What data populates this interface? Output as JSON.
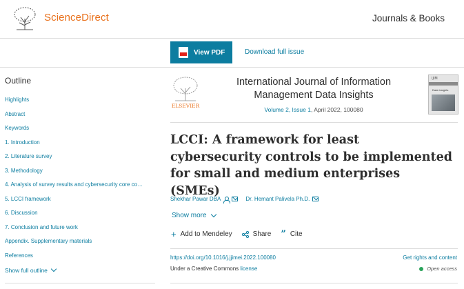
{
  "header": {
    "brand": "ScienceDirect",
    "journals_books": "Journals & Books"
  },
  "toolbar": {
    "view_pdf": "View PDF",
    "download_issue": "Download full issue"
  },
  "sidebar": {
    "title": "Outline",
    "items": [
      {
        "label": "Highlights"
      },
      {
        "label": "Abstract"
      },
      {
        "label": "Keywords"
      },
      {
        "label": "1. Introduction"
      },
      {
        "label": "2. Literature survey"
      },
      {
        "label": "3. Methodology"
      },
      {
        "label": "4. Analysis of survey results and cybersecurity core co…"
      },
      {
        "label": "5. LCCI framework"
      },
      {
        "label": "6. Discussion"
      },
      {
        "label": "7. Conclusion and future work"
      },
      {
        "label": "Appendix. Supplementary materials"
      },
      {
        "label": "References"
      }
    ],
    "show_full": "Show full outline"
  },
  "journal": {
    "publisher_logo_text": "ELSEVIER",
    "name": "International Journal of Information Management Data Insights",
    "volume": "Volume 2, Issue 1",
    "date_pages": ", April 2022, 100080",
    "cover_code": "IJIM",
    "cover_title": "Data Insights"
  },
  "article": {
    "title": "LCCI: A framework for least cybersecurity controls to be implemented for small and medium enterprises (SMEs)",
    "author1": "Shekhar Pawar DBA",
    "author2": "Dr. Hemant Palivela Ph.D.",
    "show_more": "Show more",
    "actions": {
      "mendeley": "Add to Mendeley",
      "share": "Share",
      "cite": "Cite"
    },
    "doi": "https://doi.org/10.1016/j.jjimei.2022.100080",
    "rights": "Get rights and content",
    "license_prefix": "Under a Creative Commons ",
    "license_link": "license",
    "open_access": "Open access"
  },
  "colors": {
    "brand_orange": "#e9711c",
    "link_blue": "#0c7da0",
    "open_access_green": "#29a35a"
  }
}
